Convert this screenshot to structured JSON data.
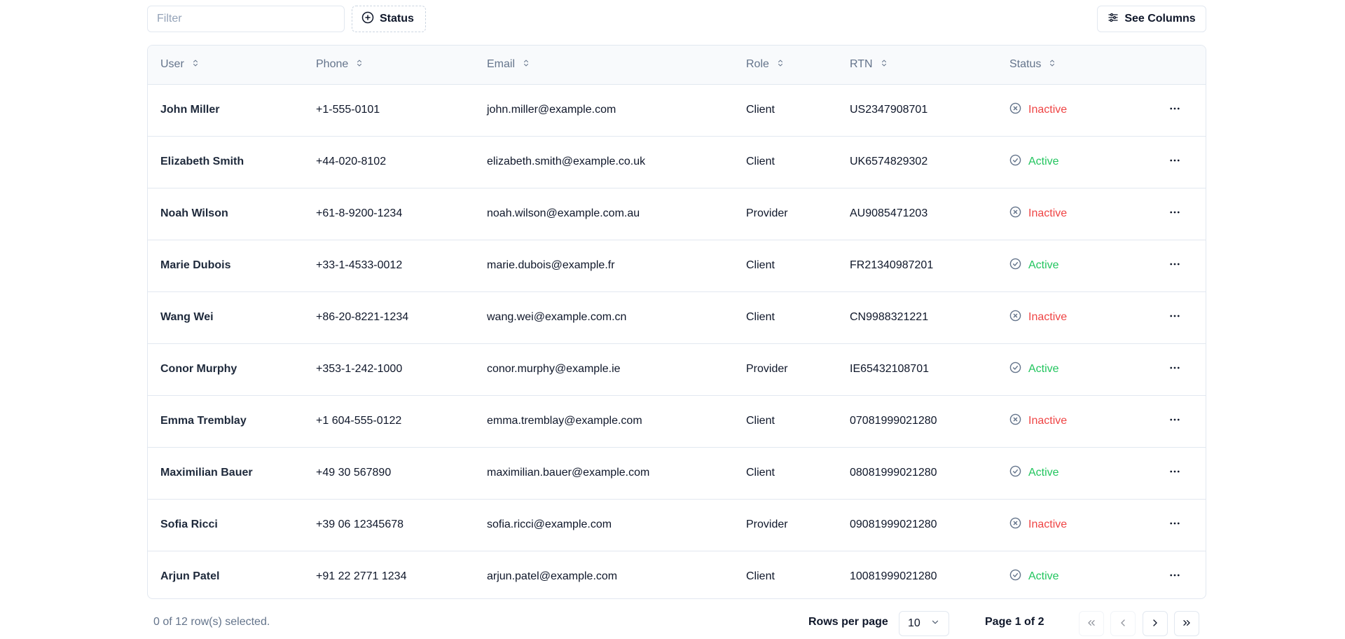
{
  "toolbar": {
    "filter_placeholder": "Filter",
    "filter_value": "",
    "status_label": "Status",
    "see_columns_label": "See Columns"
  },
  "table": {
    "columns": [
      "User",
      "Phone",
      "Email",
      "Role",
      "RTN",
      "Status"
    ],
    "rows": [
      {
        "user": "John Miller",
        "phone": "+1-555-0101",
        "email": "john.miller@example.com",
        "role": "Client",
        "rtn": "US2347908701",
        "status": "Inactive"
      },
      {
        "user": "Elizabeth Smith",
        "phone": "+44-020-8102",
        "email": "elizabeth.smith@example.co.uk",
        "role": "Client",
        "rtn": "UK6574829302",
        "status": "Active"
      },
      {
        "user": "Noah Wilson",
        "phone": "+61-8-9200-1234",
        "email": "noah.wilson@example.com.au",
        "role": "Provider",
        "rtn": "AU9085471203",
        "status": "Inactive"
      },
      {
        "user": "Marie Dubois",
        "phone": "+33-1-4533-0012",
        "email": "marie.dubois@example.fr",
        "role": "Client",
        "rtn": "FR21340987201",
        "status": "Active"
      },
      {
        "user": "Wang Wei",
        "phone": "+86-20-8221-1234",
        "email": "wang.wei@example.com.cn",
        "role": "Client",
        "rtn": "CN9988321221",
        "status": "Inactive"
      },
      {
        "user": "Conor Murphy",
        "phone": "+353-1-242-1000",
        "email": "conor.murphy@example.ie",
        "role": "Provider",
        "rtn": "IE65432108701",
        "status": "Active"
      },
      {
        "user": "Emma Tremblay",
        "phone": "+1 604-555-0122",
        "email": "emma.tremblay@example.com",
        "role": "Client",
        "rtn": "07081999021280",
        "status": "Inactive"
      },
      {
        "user": "Maximilian Bauer",
        "phone": "+49 30 567890",
        "email": "maximilian.bauer@example.com",
        "role": "Client",
        "rtn": "08081999021280",
        "status": "Active"
      },
      {
        "user": "Sofia Ricci",
        "phone": "+39 06 12345678",
        "email": "sofia.ricci@example.com",
        "role": "Provider",
        "rtn": "09081999021280",
        "status": "Inactive"
      },
      {
        "user": "Arjun Patel",
        "phone": "+91 22 2771 1234",
        "email": "arjun.patel@example.com",
        "role": "Client",
        "rtn": "10081999021280",
        "status": "Active"
      }
    ]
  },
  "footer": {
    "selected_text": "0 of 12 row(s) selected.",
    "rows_per_page_label": "Rows per page",
    "rows_per_page_value": "10",
    "page_text": "Page 1 of 2"
  },
  "colors": {
    "inactive": "#ef4444",
    "active": "#22c55e",
    "border": "#e2e8f0",
    "muted": "#64748b"
  },
  "icons": {
    "status_button": "plus-circle-icon",
    "see_columns": "sliders-icon",
    "sort": "chevrons-up-down-icon",
    "inactive": "x-circle-icon",
    "active": "check-circle-icon",
    "row_actions": "ellipsis-icon",
    "rows_select": "chevron-down-icon",
    "first_page": "chevrons-left-icon",
    "prev_page": "chevron-left-icon",
    "next_page": "chevron-right-icon",
    "last_page": "chevrons-right-icon"
  }
}
